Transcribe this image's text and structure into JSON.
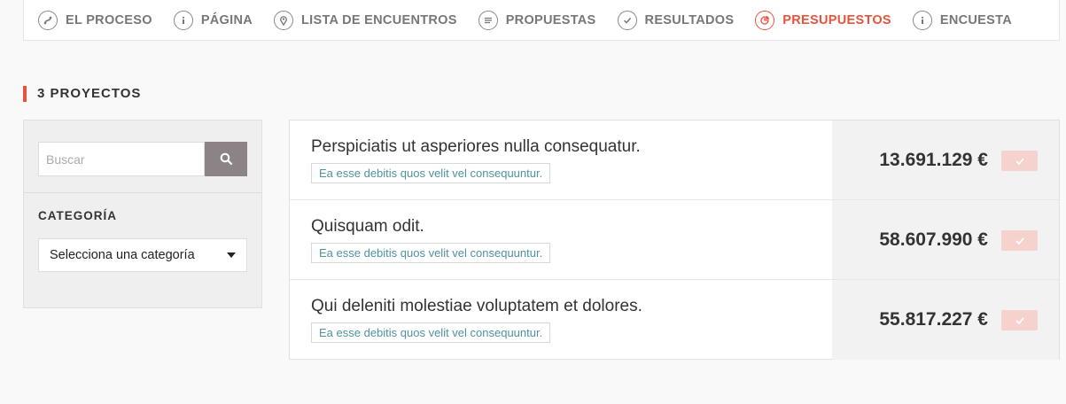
{
  "nav": {
    "items": [
      {
        "label": "EL PROCESO",
        "icon": "process-icon"
      },
      {
        "label": "PÁGINA",
        "icon": "info-icon"
      },
      {
        "label": "LISTA DE ENCUENTROS",
        "icon": "map-pin-icon"
      },
      {
        "label": "PROPUESTAS",
        "icon": "lines-icon"
      },
      {
        "label": "RESULTADOS",
        "icon": "check-icon"
      },
      {
        "label": "PRESUPUESTOS",
        "icon": "pie-chart-icon"
      },
      {
        "label": "ENCUESTA",
        "icon": "info-icon"
      }
    ],
    "active": "PRESUPUESTOS",
    "accent_color": "#e8523c"
  },
  "heading": {
    "title": "3 PROYECTOS"
  },
  "filters": {
    "search_placeholder": "Buscar",
    "category_label": "CATEGORÍA",
    "category_selected": "Selecciona una categoría"
  },
  "projects": [
    {
      "title": "Perspiciatis ut asperiores nulla consequatur.",
      "tag": "Ea esse debitis quos velit vel consequuntur.",
      "price": "13.691.129 €"
    },
    {
      "title": "Quisquam odit.",
      "tag": "Ea esse debitis quos velit vel consequuntur.",
      "price": "58.607.990 €"
    },
    {
      "title": "Qui deleniti molestiae voluptatem et dolores.",
      "tag": "Ea esse debitis quos velit vel consequuntur.",
      "price": "55.817.227 €"
    }
  ]
}
